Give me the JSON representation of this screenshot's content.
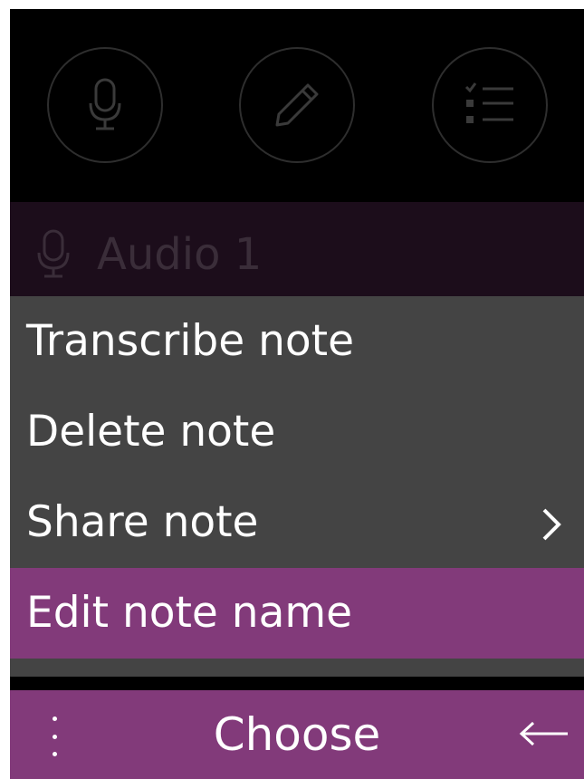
{
  "toolbar": {
    "buttons": [
      {
        "icon": "microphone-icon"
      },
      {
        "icon": "pencil-icon"
      },
      {
        "icon": "checklist-icon"
      }
    ]
  },
  "note": {
    "icon": "microphone-icon",
    "title": "Audio 1"
  },
  "menu": {
    "items": [
      {
        "label": "Transcribe note"
      },
      {
        "label": "Delete note"
      },
      {
        "label": "Share note",
        "submenu_icon": "chevron-right-icon"
      },
      {
        "label": "Edit note name"
      }
    ],
    "selected_index": 3
  },
  "softkeys": {
    "left_icon": "more-options-icon",
    "center_label": "Choose",
    "right_icon": "back-arrow-icon"
  },
  "colors": {
    "accent": "#823a7a",
    "menu_background": "#444444",
    "header_background": "#1c0d1b",
    "screen_background": "#000000"
  }
}
